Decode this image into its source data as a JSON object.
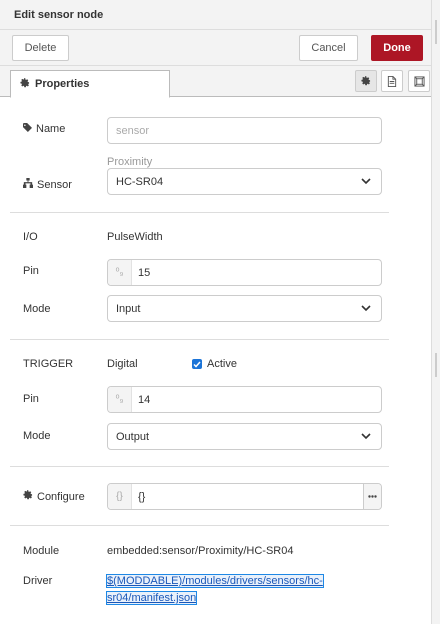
{
  "header": {
    "title": "Edit sensor node"
  },
  "toolbar": {
    "delete_label": "Delete",
    "cancel_label": "Cancel",
    "done_label": "Done",
    "done_color": "#ad1625"
  },
  "tabs": [
    {
      "label": "Properties"
    }
  ],
  "tab_icons": [
    "gear-icon",
    "description-icon",
    "appearance-icon"
  ],
  "form": {
    "name": {
      "label": "Name",
      "placeholder": "sensor",
      "value": ""
    },
    "sensor": {
      "label": "Sensor",
      "group": "Proximity",
      "value": "HC-SR04"
    },
    "io": {
      "label": "I/O",
      "type": "PulseWidth",
      "pin": {
        "label": "Pin",
        "value": "15",
        "type_glyph": "⁰₉"
      },
      "mode": {
        "label": "Mode",
        "value": "Input"
      }
    },
    "trigger": {
      "label": "TRIGGER",
      "type": "Digital",
      "active_label": "Active",
      "active_checked": true,
      "pin": {
        "label": "Pin",
        "value": "14",
        "type_glyph": "⁰₉"
      },
      "mode": {
        "label": "Mode",
        "value": "Output"
      }
    },
    "configure": {
      "label": "Configure",
      "type_glyph": "{}",
      "value": "{}"
    },
    "module": {
      "label": "Module",
      "value": "embedded:sensor/Proximity/HC-SR04"
    },
    "driver": {
      "label": "Driver",
      "line1": "$(MODDABLE)/modules/drivers/sensors/hc-",
      "line2": "sr04/manifest.json"
    }
  },
  "colors": {
    "accent": "#1b74d8",
    "link": "#1a57b8"
  }
}
